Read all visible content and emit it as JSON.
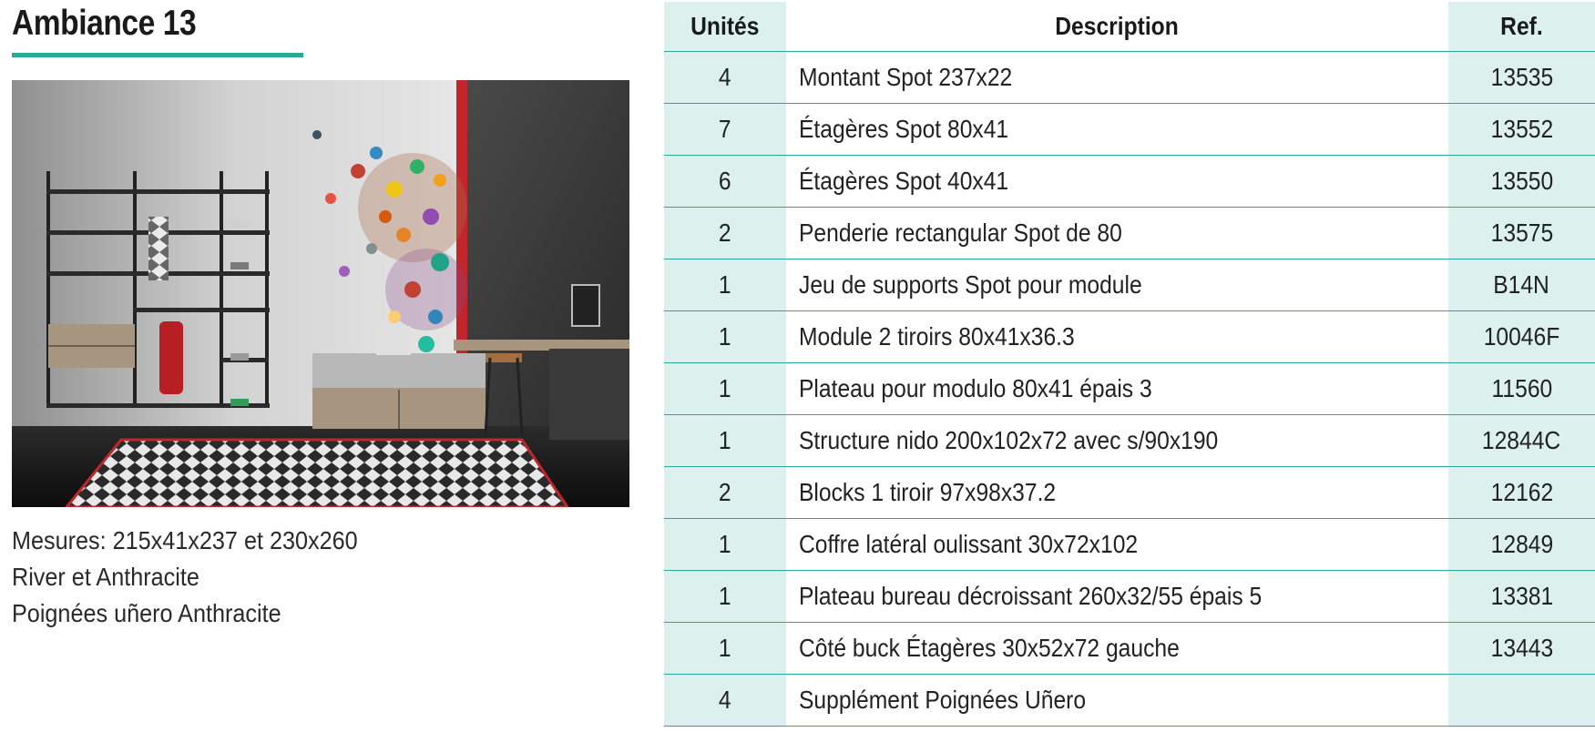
{
  "header": {
    "title": "Ambiance 13"
  },
  "specs": [
    "Mesures: 215x41x237 et 230x260",
    "River et Anthracite",
    "Poignées uñero Anthracite"
  ],
  "table": {
    "headers": {
      "units": "Unités",
      "description": "Description",
      "ref": "Ref."
    },
    "rows": [
      {
        "units": "4",
        "description": "Montant Spot 237x22",
        "ref": "13535"
      },
      {
        "units": "7",
        "description": "Étagères Spot 80x41",
        "ref": "13552"
      },
      {
        "units": "6",
        "description": "Étagères Spot 40x41",
        "ref": "13550"
      },
      {
        "units": "2",
        "description": "Penderie rectangular Spot de 80",
        "ref": "13575"
      },
      {
        "units": "1",
        "description": "Jeu de supports Spot pour module",
        "ref": "B14N"
      },
      {
        "units": "1",
        "description": "Module 2 tiroirs 80x41x36.3",
        "ref": "10046F"
      },
      {
        "units": "1",
        "description": "Plateau pour modulo 80x41 épais 3",
        "ref": "11560"
      },
      {
        "units": "1",
        "description": "Structure nido 200x102x72 avec s/90x190",
        "ref": "12844C"
      },
      {
        "units": "2",
        "description": "Blocks 1 tiroir 97x98x37.2",
        "ref": "12162"
      },
      {
        "units": "1",
        "description": "Coffre latéral oulissant 30x72x102",
        "ref": "12849"
      },
      {
        "units": "1",
        "description": "Plateau bureau décroissant 260x32/55 épais 5",
        "ref": "13381"
      },
      {
        "units": "1",
        "description": "Côté buck Étagères 30x52x72 gauche",
        "ref": "13443"
      },
      {
        "units": "4",
        "description": "Supplément Poignées Uñero",
        "ref": ""
      }
    ]
  },
  "colors": {
    "accent": "#2aa89a",
    "tint": "#dcf1ee"
  }
}
